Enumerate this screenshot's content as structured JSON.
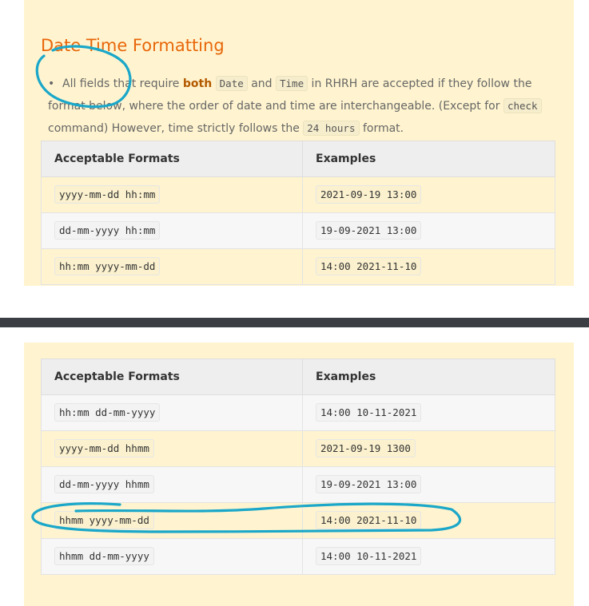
{
  "section": {
    "title": "Date Time Formatting"
  },
  "note": {
    "text_1": "All fields that require ",
    "bold": "both",
    "code_date": "Date",
    "text_and": " and ",
    "code_time": "Time",
    "text_2": " in RHRH are accepted if they follow the format below, where the order of date and time are interchangeable. (Except for ",
    "code_check": "check",
    "text_3": " command) However, time strictly follows the ",
    "code_24": "24 hours",
    "text_4": " format."
  },
  "table_top": {
    "headers": [
      "Acceptable Formats",
      "Examples"
    ],
    "rows": [
      {
        "format": "yyyy-mm-dd hh:mm",
        "example": "2021-09-19 13:00"
      },
      {
        "format": "dd-mm-yyyy hh:mm",
        "example": "19-09-2021 13:00"
      },
      {
        "format": "hh:mm yyyy-mm-dd",
        "example": "14:00 2021-11-10"
      }
    ]
  },
  "table_bottom": {
    "headers": [
      "Acceptable Formats",
      "Examples"
    ],
    "rows": [
      {
        "format": "hh:mm dd-mm-yyyy",
        "example": "14:00 10-11-2021"
      },
      {
        "format": "yyyy-mm-dd hhmm",
        "example": "2021-09-19 1300"
      },
      {
        "format": "dd-mm-yyyy hhmm",
        "example": "19-09-2021 13:00"
      },
      {
        "format": "hhmm yyyy-mm-dd",
        "example": "14:00 2021-11-10"
      },
      {
        "format": "hhmm dd-mm-yyyy",
        "example": "14:00 10-11-2021"
      }
    ]
  },
  "colors": {
    "panel_bg": "#fff4cf",
    "title_orange": "#e8660a",
    "annotation_blue": "#1aa7c9",
    "divider": "#3b3f44"
  }
}
